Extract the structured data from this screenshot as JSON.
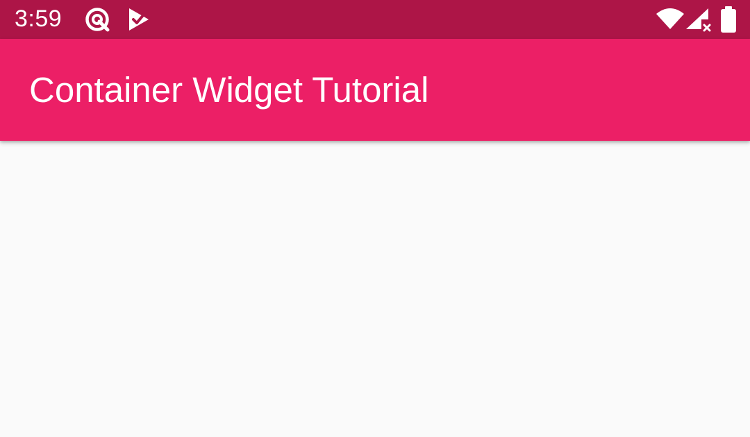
{
  "status_bar": {
    "time": "3:59",
    "background": "#ad1547",
    "notification_icons": [
      "quad-notification-icon",
      "play-store-check-icon"
    ],
    "system_icons": [
      "wifi-icon",
      "cell-signal-no-service-icon",
      "battery-icon"
    ]
  },
  "app_bar": {
    "title": "Container Widget Tutorial",
    "background": "#ec1f66"
  },
  "body": {
    "background": "#fafafa"
  }
}
